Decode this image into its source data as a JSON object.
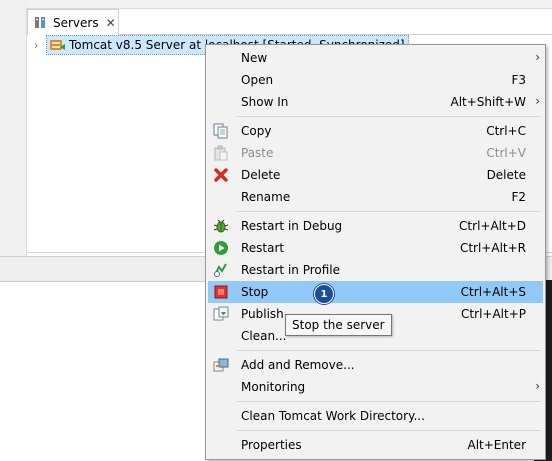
{
  "view": {
    "tab_label": "Servers",
    "tab_close": "✕",
    "tree_chevron": "›",
    "server_label": "Tomcat v8.5 Server at localhost  [Started, Synchronized]"
  },
  "menu": {
    "new": {
      "label": "New",
      "submenu": "›"
    },
    "open": {
      "label": "Open",
      "accel": "F3"
    },
    "show_in": {
      "label": "Show In",
      "accel": "Alt+Shift+W",
      "submenu": "›"
    },
    "copy": {
      "label": "Copy",
      "accel": "Ctrl+C"
    },
    "paste": {
      "label": "Paste",
      "accel": "Ctrl+V"
    },
    "delete": {
      "label": "Delete",
      "accel": "Delete"
    },
    "rename": {
      "label": "Rename",
      "accel": "F2"
    },
    "restart_debug": {
      "label": "Restart in Debug",
      "accel": "Ctrl+Alt+D"
    },
    "restart": {
      "label": "Restart",
      "accel": "Ctrl+Alt+R"
    },
    "restart_profile": {
      "label": "Restart in Profile"
    },
    "stop": {
      "label": "Stop",
      "accel": "Ctrl+Alt+S",
      "badge": "1"
    },
    "publish": {
      "label": "Publish",
      "accel": "Ctrl+Alt+P"
    },
    "clean": {
      "label": "Clean..."
    },
    "add_remove": {
      "label": "Add and Remove..."
    },
    "monitoring": {
      "label": "Monitoring",
      "submenu": "›"
    },
    "clean_work_dir": {
      "label": "Clean Tomcat Work Directory..."
    },
    "properties": {
      "label": "Properties",
      "accel": "Alt+Enter"
    }
  },
  "tooltip": {
    "text": "Stop the server"
  },
  "colors": {
    "highlight": "#91c9f7",
    "selection": "#cce8ff",
    "menu_bg": "#f2f2f2",
    "badge": "#1d4c9b",
    "stop_red": "#e0322f",
    "restart_green": "#2e9e3a"
  },
  "icons": {
    "tab": "servers-icon",
    "server": "tomcat-server-icon",
    "copy": "copy-icon",
    "paste": "paste-icon",
    "delete": "delete-icon",
    "restart_debug": "debug-bug-icon",
    "restart": "run-icon",
    "restart_profile": "profile-icon",
    "stop": "stop-icon",
    "publish": "publish-icon",
    "add_remove": "add-remove-icon"
  }
}
